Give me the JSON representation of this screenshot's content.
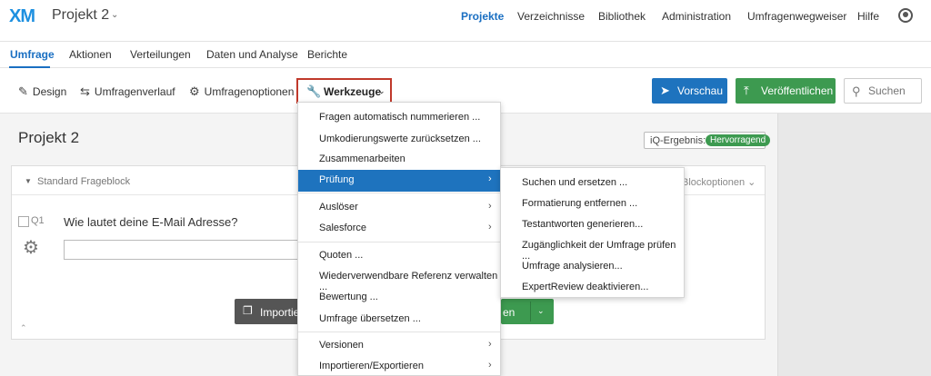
{
  "topnav": {
    "logo_x": "X",
    "logo_m": "M",
    "project_title": "Projekt 2",
    "links": [
      "Projekte",
      "Verzeichnisse",
      "Bibliothek",
      "Administration",
      "Umfragenwegweiser",
      "Hilfe"
    ],
    "active_link": "Projekte"
  },
  "subnav": {
    "tabs": [
      "Umfrage",
      "Aktionen",
      "Verteilungen",
      "Daten und Analyse",
      "Berichte"
    ],
    "active_tab": "Umfrage"
  },
  "toolbar": {
    "design": "Design",
    "history": "Umfragenverlauf",
    "options": "Umfragenoptionen",
    "tools": "Werkzeuge",
    "preview": "Vorschau",
    "publish": "Veröffentlichen",
    "search_placeholder": "Suchen"
  },
  "survey": {
    "title": "Projekt 2",
    "iq_label": "iQ-Ergebnis:",
    "iq_value": "Hervorragend",
    "block_name": "Standard Frageblock",
    "block_options": "Blockoptionen",
    "question_id": "Q1",
    "question_text": "Wie lautet deine E-Mail Adresse?",
    "import_label": "Importie",
    "green_button_label": "en"
  },
  "tools_menu": {
    "items": [
      {
        "label": "Fragen automatisch nummerieren ...",
        "has_submenu": false
      },
      {
        "label": "Umkodierungswerte zurücksetzen ...",
        "has_submenu": false
      },
      {
        "label": "Zusammenarbeiten",
        "has_submenu": false
      },
      {
        "label": "Prüfung",
        "has_submenu": true,
        "highlighted": true
      },
      {
        "label": "Auslöser",
        "has_submenu": true
      },
      {
        "label": "Salesforce",
        "has_submenu": true
      },
      {
        "label": "Quoten ...",
        "has_submenu": false
      },
      {
        "label": "Wiederverwendbare Referenz verwalten ...",
        "has_submenu": false
      },
      {
        "label": "Bewertung ...",
        "has_submenu": false
      },
      {
        "label": "Umfrage übersetzen ...",
        "has_submenu": false
      },
      {
        "label": "Versionen",
        "has_submenu": true
      },
      {
        "label": "Importieren/Exportieren",
        "has_submenu": true
      }
    ]
  },
  "pruefung_submenu": {
    "items": [
      "Suchen und ersetzen ...",
      "Formatierung entfernen ...",
      "Testantworten generieren...",
      "Zugänglichkeit der Umfrage prüfen ...",
      "Umfrage analysieren...",
      "ExpertReview deaktivieren..."
    ]
  },
  "colors": {
    "accent_blue": "#1e73be",
    "brand_blue": "#1e90e0",
    "green": "#3d9a50",
    "highlight_border": "#c0392b"
  }
}
